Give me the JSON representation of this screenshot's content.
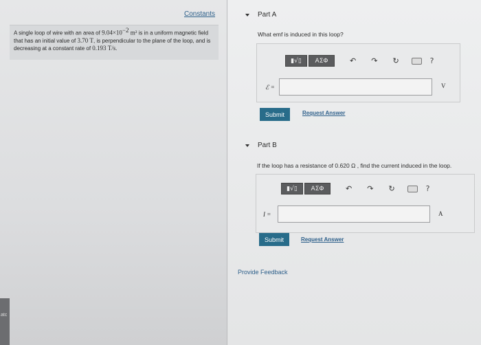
{
  "constants_link": "Constants",
  "problem": {
    "p1": "A single loop of wire with an area of ",
    "area": "9.04×10",
    "area_exp": "−2",
    "area_unit": "m²",
    "p2": " is in a uniform magnetic field that has an initial value of ",
    "field": "3.70",
    "field_unit": "T",
    "p3": ", is perpendicular to the plane of the loop, and is decreasing at a constant rate of ",
    "rate": "0.193",
    "rate_unit": "T/s",
    "p4": "."
  },
  "part_a": {
    "title": "Part A",
    "question": "What emf is induced in this loop?",
    "variable": "ℰ =",
    "unit": "V",
    "submit": "Submit",
    "request": "Request Answer"
  },
  "part_b": {
    "title": "Part B",
    "question": "If the loop has a resistance of 0.620 Ω , find the current induced in the loop.",
    "variable": "I =",
    "unit": "A",
    "submit": "Submit",
    "request": "Request Answer"
  },
  "toolbar": {
    "template_btn": "▮√▯",
    "symbols_btn": "ΑΣΦ",
    "undo_icon": "↶",
    "redo_icon": "↷",
    "reset_icon": "↻",
    "help_icon": "?"
  },
  "provide_feedback": "Provide Feedback",
  "window_stub_text": "atc"
}
